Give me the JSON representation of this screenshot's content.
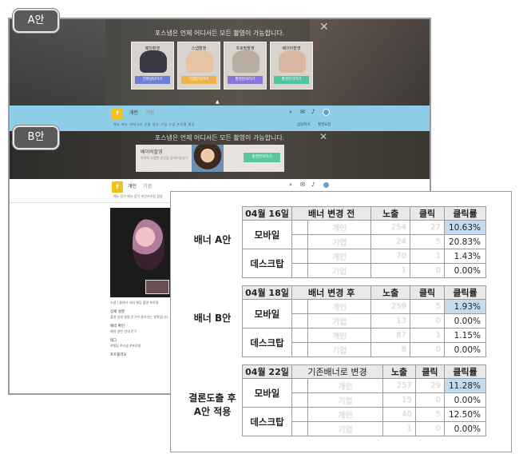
{
  "badges": {
    "a": "A안",
    "b": "B안"
  },
  "banner_a": {
    "headline": "포스냅은 언제 어디서든 모든 촬영이 가능합니다.",
    "close": "✕",
    "cards": [
      {
        "title": "웨딩촬영",
        "button": "간편상담하기",
        "color": "#6b7fd6"
      },
      {
        "title": "스냅촬영",
        "button": "디엠문의하기",
        "color": "#f0b24a"
      },
      {
        "title": "프로필촬영",
        "button": "촬영문의하기",
        "color": "#8a76d8"
      },
      {
        "title": "베이비촬영",
        "button": "촬영문의하기",
        "color": "#4fc4a0"
      }
    ]
  },
  "nav_a": {
    "tab_personal": "개인",
    "tab_company": "기업",
    "sub_menu": "메뉴 메뉴 카테고리 인물 영상 기업 스냅 프로필 웨딩",
    "right_1": "상담하기",
    "right_2": "촬영요청"
  },
  "banner_b": {
    "headline": "포스냅은 언제 어디서든 모든 촬영이 가능합니다.",
    "box_title": "베이비촬영",
    "box_desc": "아이의 소중한 순간을 담아드립니다",
    "button": "촬영문의하기",
    "close": "✕"
  },
  "nav_b": {
    "tab_personal": "개인",
    "tab_company": "기업",
    "sub_menu": "메뉴 음악   메뉴 음악   개인프로필 촬영"
  },
  "content": {
    "caption": "스냅 | 클래식 야외 웨딩 촬영 프로필",
    "sections": [
      {
        "title": "상세 설명",
        "body": "촬영 상세 설명 문구가 들어가는 영역입니다."
      },
      {
        "title": "예약 확인",
        "body": "예약 관련 안내 문구"
      },
      {
        "title": "태그",
        "body": "#웨딩 #스냅 #프로필"
      },
      {
        "title": "포트폴리오",
        "body": ""
      }
    ]
  },
  "table_headers": {
    "impressions": "노출",
    "clicks": "클릭",
    "ctr": "클릭률"
  },
  "row_labels": {
    "mobile": "모바일",
    "desktop": "데스크탑"
  },
  "blurred_labels": {
    "personal": "개인",
    "company": "기업"
  },
  "blocks": [
    {
      "label": "배너 A안",
      "date": "04월 16일",
      "condition": "배너 변경 전",
      "rows": [
        {
          "impressions": "254",
          "clicks": "27",
          "ctr": "10.63%"
        },
        {
          "impressions": "24",
          "clicks": "5",
          "ctr": "20.83%"
        },
        {
          "impressions": "70",
          "clicks": "1",
          "ctr": "1.43%"
        },
        {
          "impressions": "1",
          "clicks": "0",
          "ctr": "0.00%"
        }
      ]
    },
    {
      "label": "배너 B안",
      "date": "04월 18일",
      "condition": "배너 변경 후",
      "rows": [
        {
          "impressions": "259",
          "clicks": "5",
          "ctr": "1.93%"
        },
        {
          "impressions": "13",
          "clicks": "0",
          "ctr": "0.00%"
        },
        {
          "impressions": "87",
          "clicks": "1",
          "ctr": "1.15%"
        },
        {
          "impressions": "8",
          "clicks": "0",
          "ctr": "0.00%"
        }
      ]
    },
    {
      "label": "결론도출 후\nA안 적용",
      "date": "04월 22일",
      "condition": "기존배너로 변경",
      "rows": [
        {
          "impressions": "257",
          "clicks": "29",
          "ctr": "11.28%"
        },
        {
          "impressions": "15",
          "clicks": "0",
          "ctr": "0.00%"
        },
        {
          "impressions": "40",
          "clicks": "5",
          "ctr": "12.50%"
        },
        {
          "impressions": "1",
          "clicks": "0",
          "ctr": "0.00%"
        }
      ]
    }
  ]
}
